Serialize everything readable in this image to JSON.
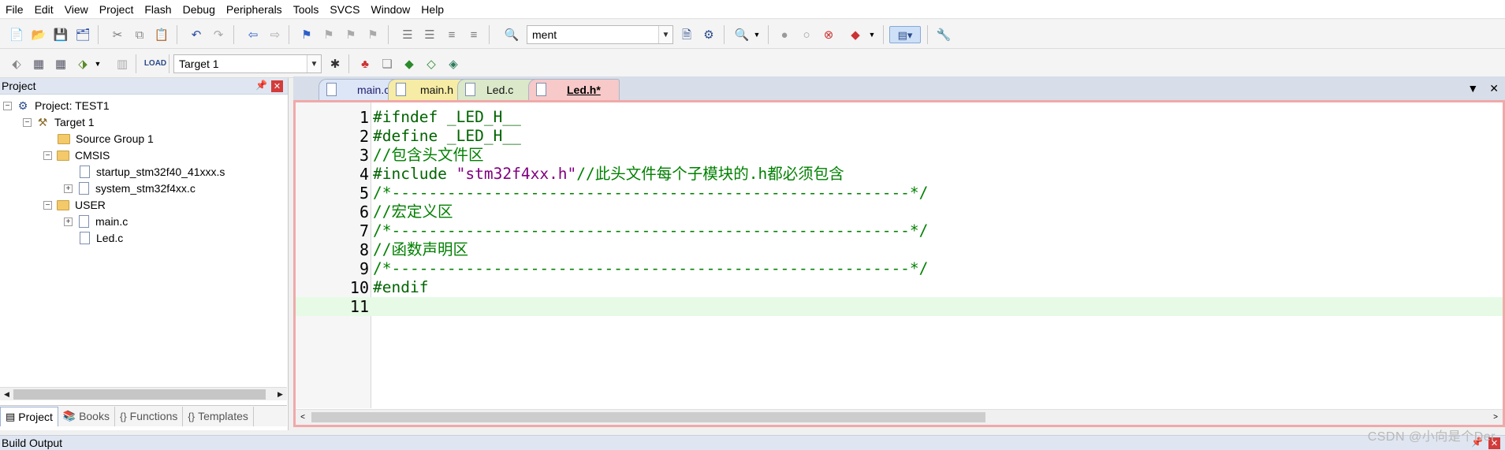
{
  "menu": [
    "File",
    "Edit",
    "View",
    "Project",
    "Flash",
    "Debug",
    "Peripherals",
    "Tools",
    "SVCS",
    "Window",
    "Help"
  ],
  "toolbar": {
    "find_combo_value": "ment",
    "target_combo_value": "Target 1"
  },
  "project_panel": {
    "title": "Project",
    "pin_glyph": "📌",
    "close_glyph": "✕",
    "tree": {
      "project": "Project: TEST1",
      "target": "Target 1",
      "group_source": "Source Group 1",
      "group_cmsis": "CMSIS",
      "file_startup": "startup_stm32f40_41xxx.s",
      "file_system": "system_stm32f4xx.c",
      "group_user": "USER",
      "file_main": "main.c",
      "file_led": "Led.c"
    },
    "tabs": {
      "project": "Project",
      "books": "Books",
      "functions": "Functions",
      "templates": "Templates"
    }
  },
  "editor": {
    "tabs": [
      "main.c",
      "main.h",
      "Led.c",
      "Led.h*"
    ],
    "active_tab": "Led.h*",
    "line_numbers": [
      "1",
      "2",
      "3",
      "4",
      "5",
      "6",
      "7",
      "8",
      "9",
      "10",
      "11"
    ],
    "code": {
      "l1": "#ifndef _LED_H__",
      "l2": "#define _LED_H__",
      "l3": "//包含头文件区",
      "l4_directive": "#include ",
      "l4_string": "\"stm32f4xx.h\"",
      "l4_comment": "//此头文件每个子模块的.h都必须包含",
      "l5": "/*--------------------------------------------------------*/",
      "l6": "//宏定义区",
      "l7": "/*--------------------------------------------------------*/",
      "l8": "//函数声明区",
      "l9": "/*--------------------------------------------------------*/",
      "l10": "#endif",
      "l11": ""
    }
  },
  "build_output": {
    "title": "Build Output"
  },
  "watermark": "CSDN @小向是个Der"
}
